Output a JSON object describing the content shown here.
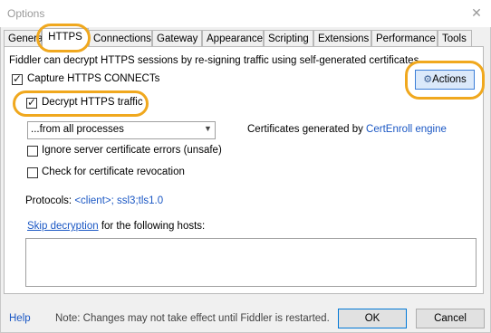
{
  "window": {
    "title": "Options",
    "close": "✕"
  },
  "tabs": [
    {
      "label": "General"
    },
    {
      "label": "HTTPS"
    },
    {
      "label": "Connections"
    },
    {
      "label": "Gateway"
    },
    {
      "label": "Appearance"
    },
    {
      "label": "Scripting"
    },
    {
      "label": "Extensions"
    },
    {
      "label": "Performance"
    },
    {
      "label": "Tools"
    }
  ],
  "https": {
    "intro": "Fiddler can decrypt HTTPS sessions by re-signing traffic using self-generated certificates.",
    "capture_label": "Capture HTTPS CONNECTs",
    "capture_checked": true,
    "decrypt_label": "Decrypt HTTPS traffic",
    "decrypt_checked": true,
    "actions_label": "Actions",
    "process_filter": "...from all processes",
    "certs_prefix": "Certificates generated by ",
    "certs_engine": "CertEnroll engine",
    "ignore_errors_label": "Ignore server certificate errors (unsafe)",
    "ignore_errors_checked": false,
    "revocation_label": "Check for certificate revocation",
    "revocation_checked": false,
    "protocols_label": "Protocols: ",
    "protocols_value": "<client>; ssl3;tls1.0",
    "skip_link": "Skip decryption",
    "skip_suffix": " for the following hosts:",
    "hosts_value": ""
  },
  "footer": {
    "help": "Help",
    "note": "Note: Changes may not take effect until Fiddler is restarted.",
    "ok": "OK",
    "cancel": "Cancel"
  },
  "colors": {
    "highlight": "#f0a81e",
    "link": "#1a57c4",
    "accent": "#0078d7"
  }
}
